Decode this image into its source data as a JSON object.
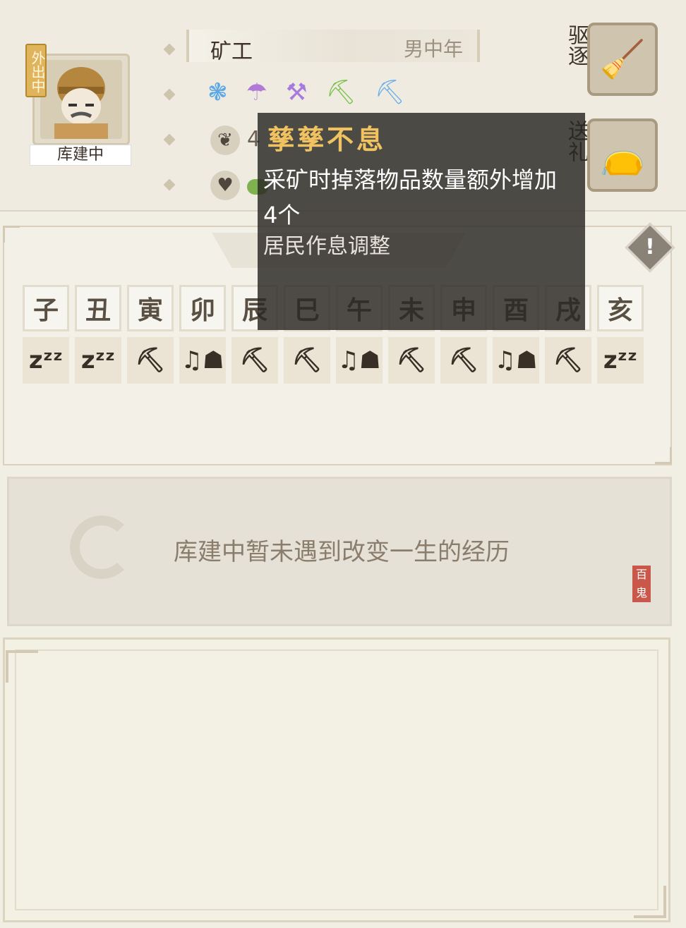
{
  "character": {
    "name": "库建中",
    "status_badge": "外出中",
    "job": "矿工",
    "demographic": "男中年",
    "stat_value": "4",
    "tool_icons": [
      "blue-beast-icon",
      "purple-mushroom-icon",
      "purple-crossed-picks-icon",
      "green-pickaxe-icon",
      "blue-pickaxe-icon"
    ]
  },
  "actions": {
    "expel_label": "驱逐",
    "gift_label": "送礼"
  },
  "tooltip": {
    "title": "孳孳不息",
    "description_line1": "采矿时掉落物品数量额外增加",
    "description_line2": "4个",
    "subtitle": "居民作息调整"
  },
  "schedule": {
    "hours": [
      "子",
      "丑",
      "寅",
      "卯",
      "辰",
      "巳",
      "午",
      "未",
      "申",
      "酉",
      "戌",
      "亥"
    ],
    "activities": [
      "sleep",
      "sleep",
      "mine",
      "leisure",
      "mine",
      "mine",
      "leisure",
      "mine",
      "mine",
      "leisure",
      "mine",
      "sleep"
    ],
    "activity_glyphs": {
      "sleep": "zᶻᶻ",
      "mine": "⛏",
      "leisure": "♫☗"
    }
  },
  "story": {
    "text": "库建中暂未遇到改变一生的经历",
    "seal_text": "百鬼"
  },
  "colors": {
    "background": "#f1eee4",
    "tooltip_title": "#f0c260",
    "badge": "#e0b45a"
  }
}
